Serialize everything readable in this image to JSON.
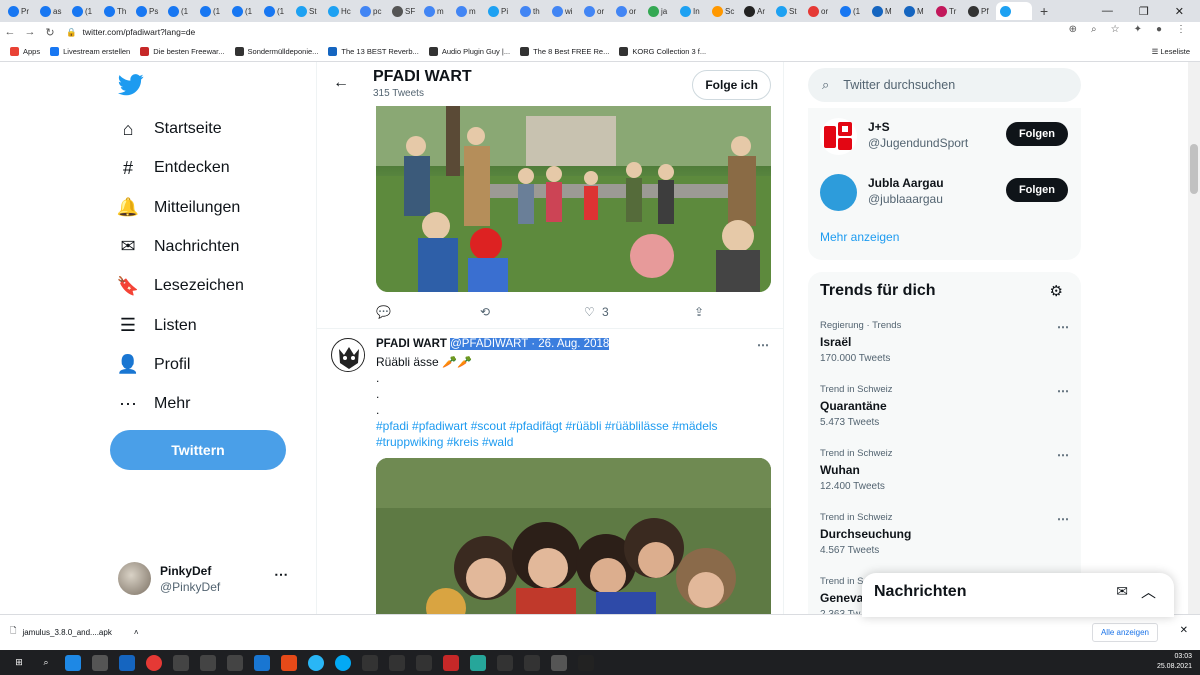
{
  "browser": {
    "tabs": [
      {
        "label": "Pr",
        "color": "#1877f2"
      },
      {
        "label": "as",
        "color": "#1877f2"
      },
      {
        "label": "(1",
        "color": "#1877f2"
      },
      {
        "label": "Th",
        "color": "#1877f2"
      },
      {
        "label": "Ps",
        "color": "#1877f2"
      },
      {
        "label": "(1",
        "color": "#1877f2"
      },
      {
        "label": "(1",
        "color": "#1877f2"
      },
      {
        "label": "(1",
        "color": "#1877f2"
      },
      {
        "label": "(1",
        "color": "#1877f2"
      },
      {
        "label": "St",
        "color": "#1da1f2"
      },
      {
        "label": "Hc",
        "color": "#1da1f2"
      },
      {
        "label": "pc",
        "color": "#4285f4"
      },
      {
        "label": "SF",
        "color": "#555"
      },
      {
        "label": "m",
        "color": "#4285f4"
      },
      {
        "label": "m",
        "color": "#4285f4"
      },
      {
        "label": "Pi",
        "color": "#1da1f2"
      },
      {
        "label": "th",
        "color": "#4285f4"
      },
      {
        "label": "wi",
        "color": "#4285f4"
      },
      {
        "label": "or",
        "color": "#4285f4"
      },
      {
        "label": "or",
        "color": "#4285f4"
      },
      {
        "label": "ja",
        "color": "#34a853"
      },
      {
        "label": "In",
        "color": "#1da1f2"
      },
      {
        "label": "Sc",
        "color": "#ff9800"
      },
      {
        "label": "Ar",
        "color": "#222"
      },
      {
        "label": "St",
        "color": "#1da1f2"
      },
      {
        "label": "or",
        "color": "#e53935"
      },
      {
        "label": "(1",
        "color": "#1877f2"
      },
      {
        "label": "M",
        "color": "#1565c0"
      },
      {
        "label": "M",
        "color": "#1565c0"
      },
      {
        "label": "Tr",
        "color": "#c2185b"
      },
      {
        "label": "Pf",
        "color": "#333"
      },
      {
        "label": "",
        "color": "#1da1f2"
      }
    ],
    "url": "twitter.com/pfadiwart?lang=de",
    "bookmarks": [
      {
        "label": "Apps",
        "color": "#e94235"
      },
      {
        "label": "Livestream erstellen",
        "color": "#1877f2"
      },
      {
        "label": "Die besten Freewar...",
        "color": "#c62828"
      },
      {
        "label": "Sondermülldeponie...",
        "color": "#333"
      },
      {
        "label": "The 13 BEST Reverb...",
        "color": "#1565c0"
      },
      {
        "label": "Audio Plugin Guy |...",
        "color": "#333"
      },
      {
        "label": "The 8 Best FREE Re...",
        "color": "#333"
      },
      {
        "label": "KORG Collection 3 f...",
        "color": "#333"
      }
    ],
    "reading_list": "Leseliste"
  },
  "leftnav": {
    "items": [
      {
        "label": "Startseite",
        "icon": "home-icon",
        "glyph": "⌂"
      },
      {
        "label": "Entdecken",
        "icon": "hashtag-icon",
        "glyph": "#"
      },
      {
        "label": "Mitteilungen",
        "icon": "bell-icon",
        "glyph": "🔔"
      },
      {
        "label": "Nachrichten",
        "icon": "mail-icon",
        "glyph": "✉"
      },
      {
        "label": "Lesezeichen",
        "icon": "bookmark-icon",
        "glyph": "🔖"
      },
      {
        "label": "Listen",
        "icon": "list-icon",
        "glyph": "☰"
      },
      {
        "label": "Profil",
        "icon": "person-icon",
        "glyph": "👤"
      },
      {
        "label": "Mehr",
        "icon": "more-circle-icon",
        "glyph": "⋯"
      }
    ],
    "tweet_button": "Twittern",
    "user": {
      "name": "PinkyDef",
      "handle": "@PinkyDef",
      "more": "⋯"
    }
  },
  "header": {
    "title": "PFADI WART",
    "subtitle": "315 Tweets",
    "follow": "Folge ich"
  },
  "tweet1": {
    "replies": "",
    "retweets": "",
    "likes": "3"
  },
  "tweet2": {
    "name": "PFADI WART",
    "handle": "@PFADIWART",
    "sep": " · ",
    "date": "26. Aug. 2018",
    "line1": "Rüäbli ässe 🥕🥕",
    "dot": ".",
    "hashtags1": "#pfadi #pfadiwart #scout #pfadifägt #rüäbli #rüäblilässe #mädels",
    "hashtags2": "#truppwiking #kreis #wald",
    "more": "⋯"
  },
  "right": {
    "search_placeholder": "Twitter durchsuchen",
    "accounts": [
      {
        "name": "J+S",
        "handle": "@JugendundSport",
        "button": "Folgen",
        "color": "#e30613"
      },
      {
        "name": "Jubla Aargau",
        "handle": "@jublaaargau",
        "button": "Folgen",
        "color": "#2d9cdb"
      }
    ],
    "show_more": "Mehr anzeigen",
    "trends_title": "Trends für dich",
    "trends": [
      {
        "context": "Regierung · Trends",
        "name": "Israël",
        "count": "170.000 Tweets"
      },
      {
        "context": "Trend in Schweiz",
        "name": "Quarantäne",
        "count": "5.473 Tweets"
      },
      {
        "context": "Trend in Schweiz",
        "name": "Wuhan",
        "count": "12.400 Tweets"
      },
      {
        "context": "Trend in Schweiz",
        "name": "Durchseuchung",
        "count": "4.567 Tweets"
      },
      {
        "context": "Trend in S",
        "name": "Geneva",
        "count": "2.363 Tw"
      }
    ],
    "messages_title": "Nachrichten"
  },
  "download": {
    "file": "jamulus_3.8.0_and....apk",
    "show_all": "Alle anzeigen"
  },
  "taskbar": {
    "time": "03:03",
    "date": "25.08.2021"
  }
}
